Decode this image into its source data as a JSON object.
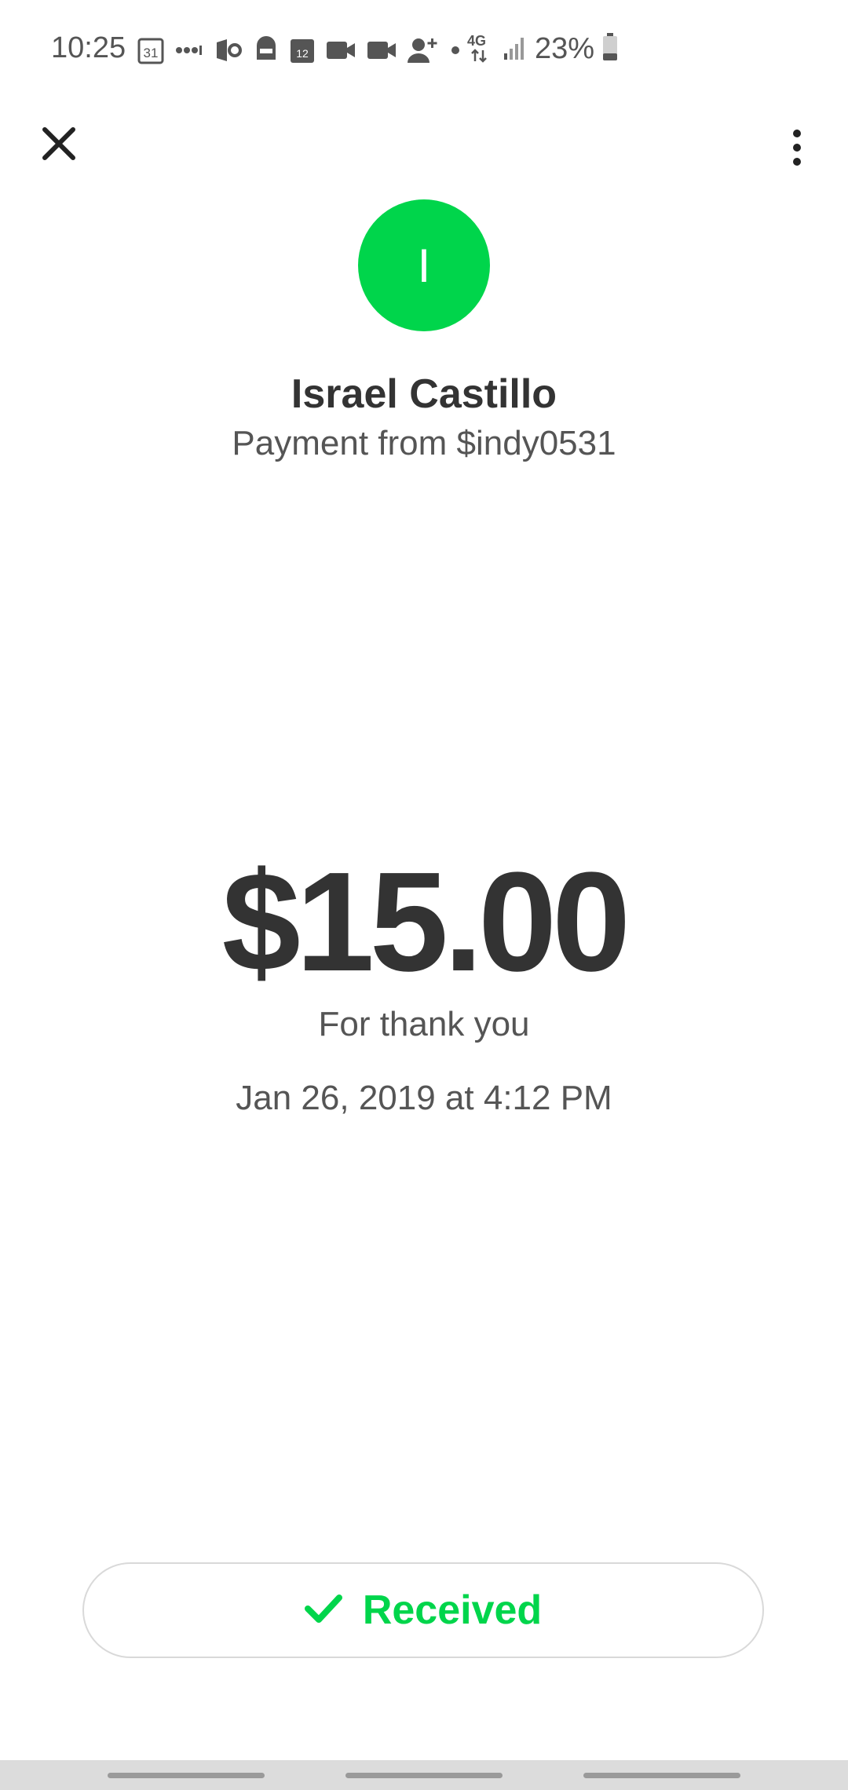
{
  "status_bar": {
    "time": "10:25",
    "calendar_day": "31",
    "calendar2_day": "12",
    "network": "4G",
    "battery_percent": "23%"
  },
  "icons": {
    "close": "close-icon",
    "more": "more-vert-icon",
    "received_check": "checkmark-icon"
  },
  "colors": {
    "accent": "#00d54b",
    "text_primary": "#333333",
    "text_secondary": "#555555"
  },
  "avatar": {
    "initial": "I"
  },
  "sender": {
    "name": "Israel Castillo",
    "subtitle": "Payment from $indy0531"
  },
  "payment": {
    "amount": "$15.00",
    "note": "For thank you",
    "datetime": "Jan 26, 2019 at 4:12 PM"
  },
  "status_button": {
    "label": "Received"
  }
}
